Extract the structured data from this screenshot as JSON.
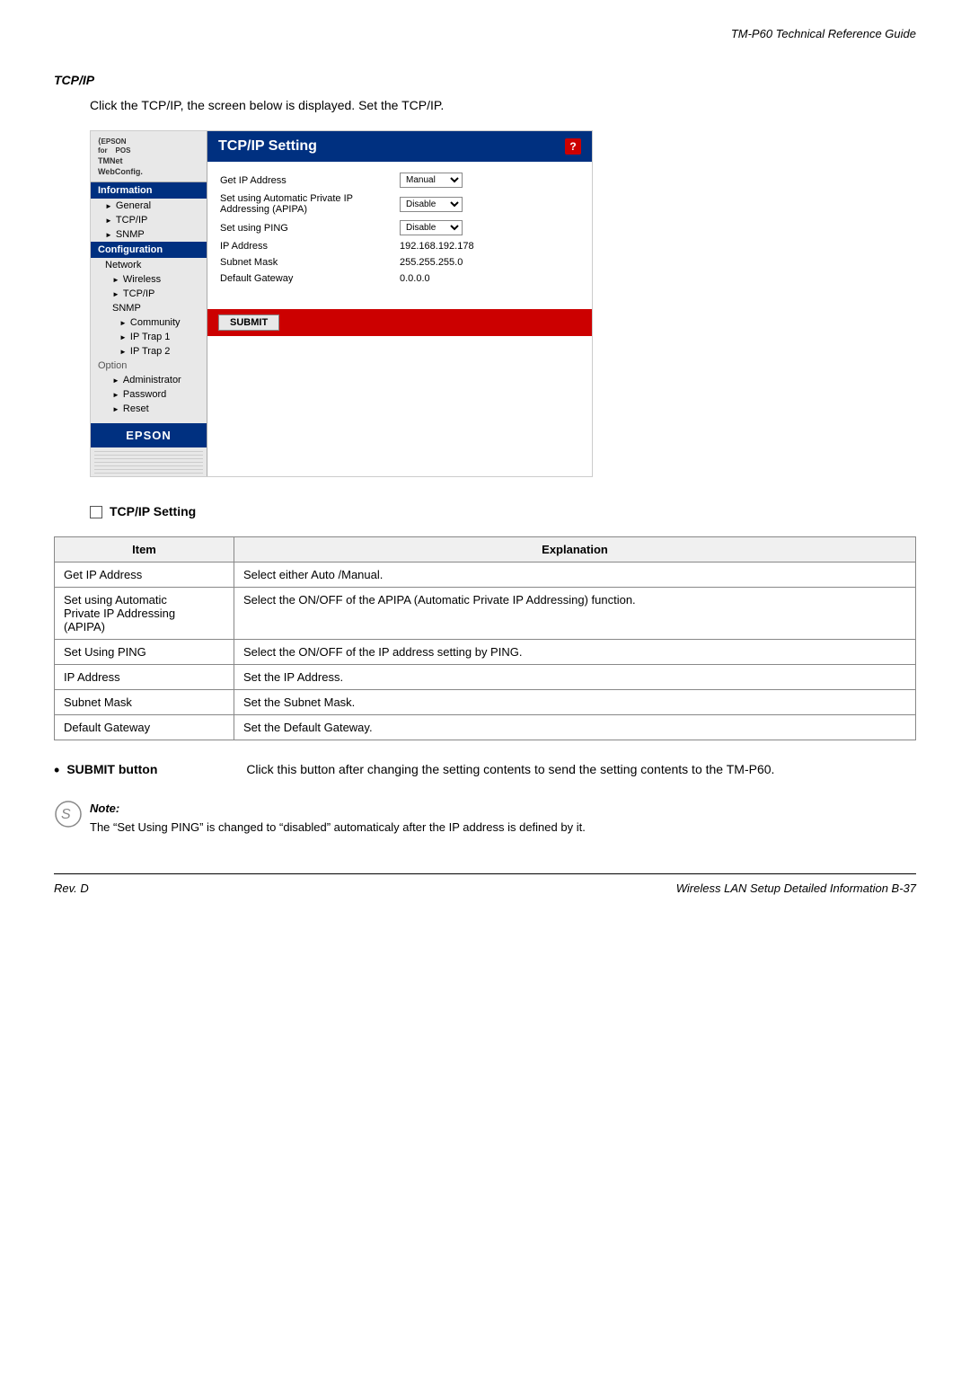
{
  "header": {
    "title": "TM-P60 Technical Reference Guide"
  },
  "section": {
    "title": "TCP/IP",
    "intro": "Click the TCP/IP, the screen below is displayed. Set the TCP/IP."
  },
  "screenshot": {
    "sidebar": {
      "logo_line1": "EPSON",
      "logo_line2": "for",
      "logo_line3": "POS",
      "tmnet_label": "TMNet",
      "webconfig_label": "WebConfig.",
      "info_section": "Information",
      "items": [
        {
          "label": "General",
          "indent": 1,
          "arrow": true
        },
        {
          "label": "TCP/IP",
          "indent": 1,
          "arrow": true
        },
        {
          "label": "SNMP",
          "indent": 1,
          "arrow": true
        }
      ],
      "config_section": "Configuration",
      "config_items": [
        {
          "label": "Network",
          "indent": 1,
          "arrow": false
        },
        {
          "label": "Wireless",
          "indent": 2,
          "arrow": true
        },
        {
          "label": "TCP/IP",
          "indent": 2,
          "arrow": true
        },
        {
          "label": "SNMP",
          "indent": 2,
          "arrow": false
        },
        {
          "label": "Community",
          "indent": 3,
          "arrow": true
        },
        {
          "label": "IP Trap 1",
          "indent": 3,
          "arrow": true
        },
        {
          "label": "IP Trap 2",
          "indent": 3,
          "arrow": true
        }
      ],
      "option_label": "Option",
      "option_items": [
        {
          "label": "Administrator",
          "indent": 2,
          "arrow": true
        },
        {
          "label": "Password",
          "indent": 2,
          "arrow": true
        },
        {
          "label": "Reset",
          "indent": 2,
          "arrow": true
        }
      ],
      "epson_label": "EPSON"
    },
    "panel": {
      "title": "TCP/IP Setting",
      "icon": "?",
      "fields": [
        {
          "label": "Get IP Address",
          "value": "Manual",
          "type": "select"
        },
        {
          "label": "Set using Automatic Private IP Addressing (APIPA)",
          "value": "Disable",
          "type": "select"
        },
        {
          "label": "Set using PING",
          "value": "Disable",
          "type": "select"
        },
        {
          "label": "IP Address",
          "value": "192.168.192.178",
          "type": "text"
        },
        {
          "label": "Subnet Mask",
          "value": "255.255.255.0",
          "type": "text"
        },
        {
          "label": "Default Gateway",
          "value": "0.0.0.0",
          "type": "text"
        }
      ],
      "submit_label": "SUBMIT"
    }
  },
  "checkbox_section": {
    "label": "TCP/IP Setting"
  },
  "table": {
    "headers": [
      "Item",
      "Explanation"
    ],
    "rows": [
      {
        "item": "Get IP Address",
        "explanation": "Select either Auto /Manual."
      },
      {
        "item": "Set using Automatic\nPrivate IP Addressing\n(APIPA)",
        "explanation": "Select the ON/OFF of the APIPA (Automatic Private IP Addressing) function."
      },
      {
        "item": "Set Using PING",
        "explanation": "Select the ON/OFF of the IP address setting by PING."
      },
      {
        "item": "IP Address",
        "explanation": "Set the IP Address."
      },
      {
        "item": "Subnet Mask",
        "explanation": "Set the Subnet Mask."
      },
      {
        "item": "Default Gateway",
        "explanation": "Set the Default Gateway."
      }
    ]
  },
  "bullet": {
    "term": "SUBMIT button",
    "description": "Click this button after changing the setting contents to send the setting contents to the TM-P60."
  },
  "note": {
    "label": "Note:",
    "text": "The “Set Using PING” is changed to “disabled” automaticaly after the IP address is defined by it."
  },
  "footer": {
    "left": "Rev. D",
    "right": "Wireless LAN Setup Detailed Information   B-37"
  }
}
